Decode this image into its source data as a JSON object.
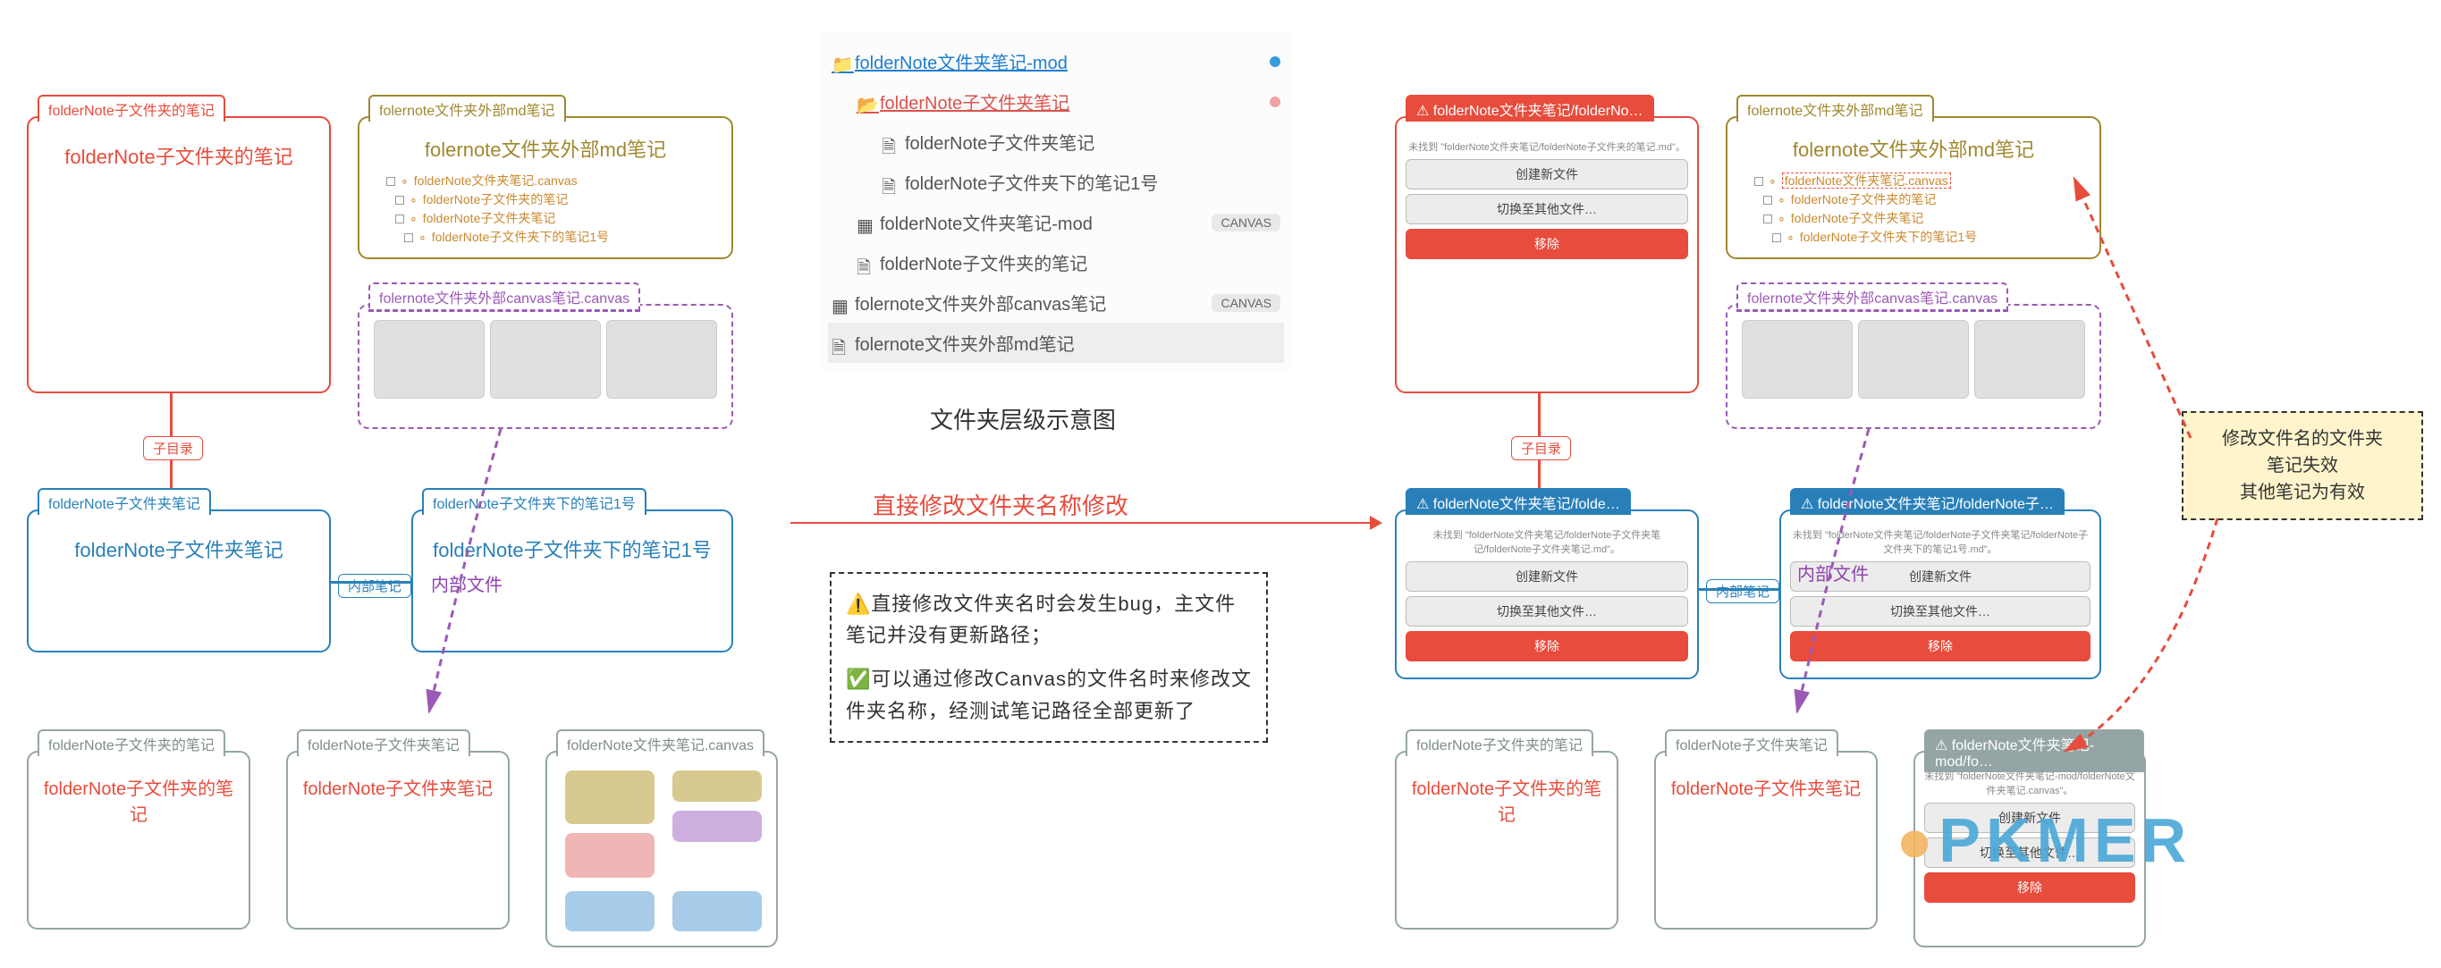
{
  "left": {
    "card1": {
      "tab": "folderNote子文件夹的笔记",
      "title": "folderNote子文件夹的笔记"
    },
    "card2": {
      "tab": "folernote文件夹外部md笔记",
      "title": "folernote文件夹外部md笔记",
      "items": [
        "folderNote文件夹笔记.canvas",
        "folderNote子文件夹的笔记",
        "folderNote子文件夹笔记",
        "folderNote子文件夹下的笔记1号"
      ]
    },
    "card3": {
      "tab": "folernote文件夹外部canvas笔记.canvas"
    },
    "badge_sub": "子目录",
    "card4": {
      "tab": "folderNote子文件夹笔记",
      "title": "folderNote子文件夹笔记",
      "badge": "内部笔记"
    },
    "card5": {
      "tab": "folderNote子文件夹下的笔记1号",
      "title": "folderNote子文件夹下的笔记1号",
      "hand": "内部文件"
    },
    "g1": {
      "tab": "folderNote子文件夹的笔记",
      "title": "folderNote子文件夹的笔记"
    },
    "g2": {
      "tab": "folderNote子文件夹笔记",
      "title": "folderNote子文件夹笔记"
    },
    "g3": {
      "tab": "folderNote文件夹笔记.canvas"
    }
  },
  "tree": {
    "caption": "文件夹层级示意图",
    "rows": [
      {
        "icon": "folder",
        "text": "folderNote文件夹笔记-mod",
        "link": true,
        "dot": "#3a9bdc",
        "pill": null,
        "indent": 0
      },
      {
        "icon": "folder-open",
        "text": "folderNote子文件夹笔记",
        "link": true,
        "linkRed": true,
        "dot": "#f2a1a1",
        "indent": 1
      },
      {
        "icon": "doc",
        "text": "folderNote子文件夹笔记",
        "indent": 2
      },
      {
        "icon": "doc",
        "text": "folderNote子文件夹下的笔记1号",
        "indent": 2
      },
      {
        "icon": "grid",
        "text": "folderNote文件夹笔记-mod",
        "pill": "CANVAS",
        "indent": 1
      },
      {
        "icon": "doc",
        "text": "folderNote子文件夹的笔记",
        "indent": 1
      },
      {
        "icon": "grid",
        "text": "folernote文件夹外部canvas笔记",
        "pill": "CANVAS",
        "indent": 0
      },
      {
        "icon": "doc",
        "text": "folernote文件夹外部md笔记",
        "indent": 0,
        "bg": "#eee"
      }
    ]
  },
  "center": {
    "arrow_label": "直接修改文件夹名称修改",
    "warn": "⚠️直接修改文件夹名时会发生bug，主文件笔记并没有更新路径；",
    "ok": "✅可以通过修改Canvas的文件名时来修改文件夹名称，经测试笔记路径全部更新了"
  },
  "right": {
    "card1": {
      "tab": "⚠ folderNote文件夹笔记/folderNo…",
      "err": "未找到 \"folderNote文件夹笔记/folderNote子文件夹的笔记.md\"。"
    },
    "card2": {
      "tab": "folernote文件夹外部md笔记",
      "title": "folernote文件夹外部md笔记",
      "items": [
        "folderNote文件夹笔记.canvas",
        "folderNote子文件夹的笔记",
        "folderNote子文件夹笔记",
        "folderNote子文件夹下的笔记1号"
      ]
    },
    "card3": {
      "tab": "folernote文件夹外部canvas笔记.canvas"
    },
    "badge_sub": "子目录",
    "card4": {
      "tab": "⚠ folderNote文件夹笔记/folde…",
      "err": "未找到 \"folderNote文件夹笔记/folderNote子文件夹笔记/folderNote子文件夹笔记.md\"。",
      "badge": "内部笔记"
    },
    "card5": {
      "tab": "⚠ folderNote文件夹笔记/folderNote子…",
      "err": "未找到 \"folderNote文件夹笔记/folderNote子文件夹笔记/folderNote子文件夹下的笔记1号.md\"。",
      "hand": "内部文件"
    },
    "g1": {
      "tab": "folderNote子文件夹的笔记",
      "title": "folderNote子文件夹的笔记"
    },
    "g2": {
      "tab": "folderNote子文件夹笔记",
      "title": "folderNote子文件夹笔记"
    },
    "g3": {
      "tab": "⚠ folderNote文件夹笔记-mod/fo…",
      "err": "未找到 \"folderNote文件夹笔记-mod/folderNote文件夹笔记.canvas\"。"
    },
    "buttons": {
      "create": "创建新文件",
      "switch": "切换至其他文件…",
      "remove": "移除"
    }
  },
  "yellow": {
    "l1": "修改文件名的文件夹",
    "l2": "笔记失效",
    "l3": "其他笔记为有效"
  },
  "watermark": "PKMER"
}
